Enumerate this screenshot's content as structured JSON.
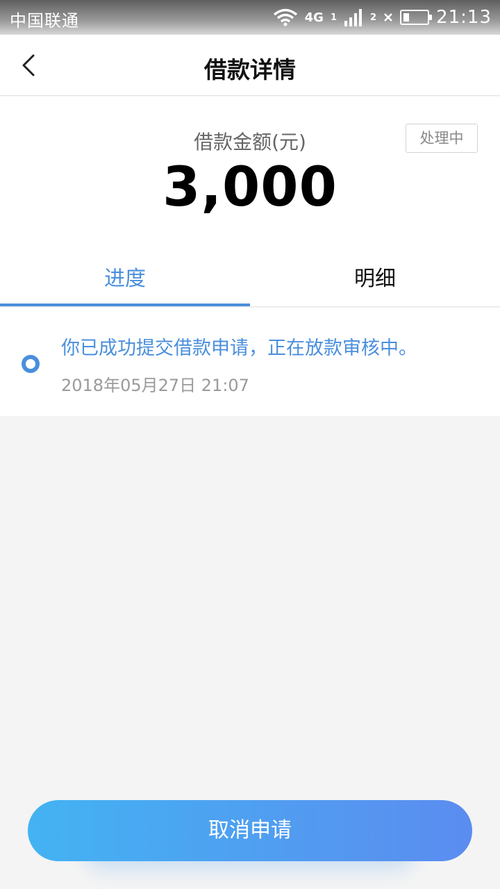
{
  "status_bar": {
    "carrier": "中国联通",
    "network": "4G",
    "sim1": "1",
    "sim2": "2",
    "time": "21:13"
  },
  "header": {
    "title": "借款详情",
    "back_icon": "chevron-left-icon"
  },
  "summary": {
    "amount_label": "借款金额(元)",
    "amount": "3,000",
    "status": "处理中"
  },
  "tabs": [
    {
      "label": "进度",
      "active": true
    },
    {
      "label": "明细",
      "active": false
    }
  ],
  "timeline": [
    {
      "message": "你已成功提交借款申请，正在放款审核中。",
      "time": "2018年05月27日 21:07"
    }
  ],
  "actions": {
    "cancel_label": "取消申请"
  },
  "colors": {
    "accent": "#4a8fdc",
    "button_gradient_start": "#43b3f2",
    "button_gradient_end": "#5b8cf0"
  }
}
